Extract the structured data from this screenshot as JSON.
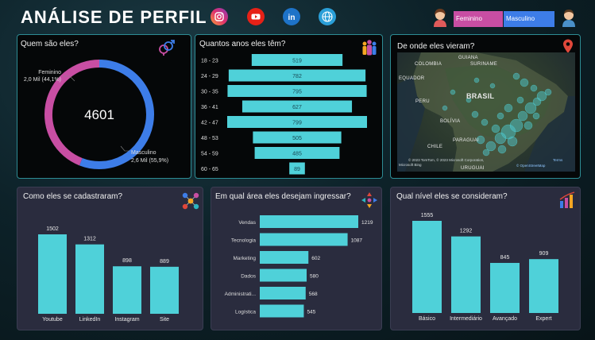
{
  "header": {
    "title": "ANÁLISE DE PERFIL",
    "icons": [
      "instagram-icon",
      "youtube-icon",
      "linkedin-icon",
      "globe-icon"
    ],
    "gender_buttons": [
      "Feminino",
      "Masculino"
    ],
    "colors": {
      "feminino": "#c84ea3",
      "masculino": "#3d7de8"
    }
  },
  "panels": {
    "gender": {
      "title": "Quem são eles?",
      "icon": "gender-symbols-icon"
    },
    "age": {
      "title": "Quantos anos eles têm?",
      "icon": "people-icon"
    },
    "map": {
      "title": "De onde eles vieram?",
      "icon": "map-pin-icon"
    },
    "signup": {
      "title": "Como eles se cadastraram?",
      "icon": "network-icon"
    },
    "area": {
      "title": "Em qual área eles desejam ingressar?",
      "icon": "arrows-icon"
    },
    "level": {
      "title": "Qual nível eles se consideram?",
      "icon": "bar-chart-icon"
    }
  },
  "map": {
    "labels": [
      "COLOMBIA",
      "GUIANA",
      "SURINAME",
      "EQUADOR",
      "PERU",
      "BRASIL",
      "BOLÍVIA",
      "PARAGUAI",
      "CHILE",
      "URUGUAI"
    ],
    "copyright": "© 2023 TomTom, © 2023 Microsoft Corporation,",
    "terms": "Terms",
    "osm": "© OpenStreetMap",
    "bing": "Microsoft Bing"
  },
  "chart_data": [
    {
      "type": "pie",
      "center_label": "4601",
      "categories": [
        "Feminino",
        "Masculino"
      ],
      "values": [
        2.0,
        2.6
      ],
      "data_labels": [
        "2,0 Mil (44,1%)",
        "2,6 Mil (55,9%)"
      ],
      "percent": [
        44.1,
        55.9
      ],
      "colors": [
        "#c84ea3",
        "#3d7de8"
      ]
    },
    {
      "type": "bar",
      "orientation": "horizontal",
      "categories": [
        "18 - 23",
        "24 - 29",
        "30 - 35",
        "36 - 41",
        "42 - 47",
        "48 - 53",
        "54 - 59",
        "60 - 65"
      ],
      "values": [
        519,
        782,
        795,
        627,
        799,
        505,
        485,
        89
      ]
    },
    {
      "type": "bar",
      "categories": [
        "Youtube",
        "LinkedIn",
        "Instagram",
        "Site"
      ],
      "values": [
        1502,
        1312,
        898,
        889
      ]
    },
    {
      "type": "bar",
      "orientation": "horizontal",
      "categories": [
        "Vendas",
        "Tecnologia",
        "Marketing",
        "Dados",
        "Administrati...",
        "Logística"
      ],
      "values": [
        1219,
        1087,
        602,
        580,
        568,
        545
      ]
    },
    {
      "type": "bar",
      "categories": [
        "Básico",
        "Intermediário",
        "Avançado",
        "Expert"
      ],
      "values": [
        1555,
        1292,
        845,
        909
      ]
    }
  ]
}
